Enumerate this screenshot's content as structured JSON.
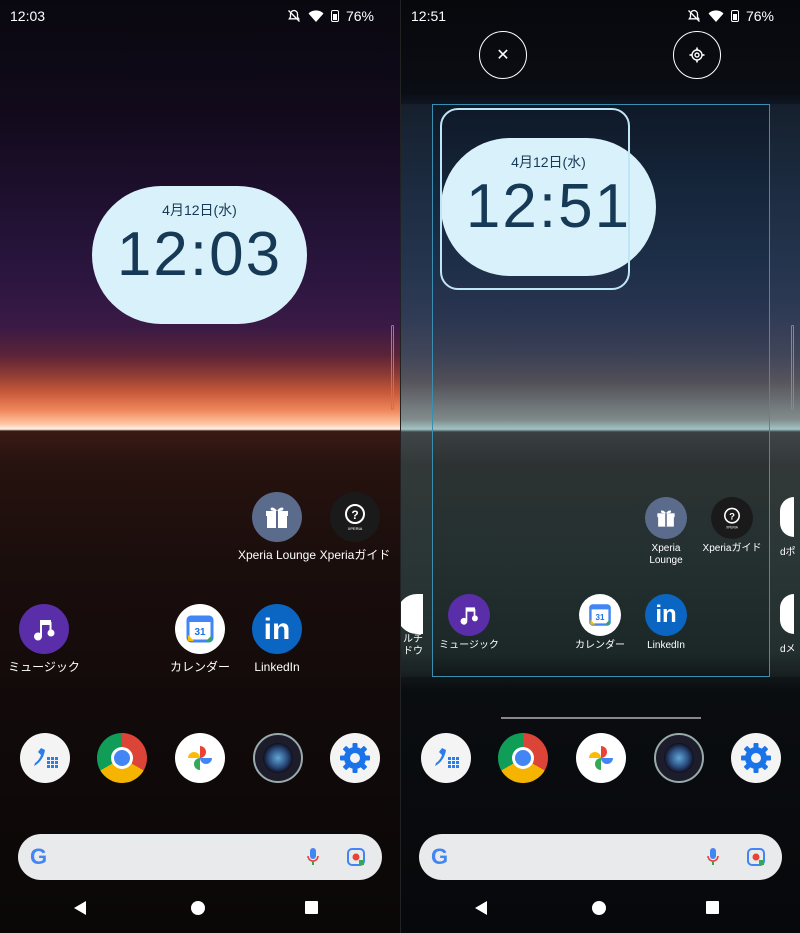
{
  "left": {
    "status": {
      "time": "12:03",
      "battery": "76%"
    },
    "clock": {
      "date": "4月12日(水)",
      "time": "12:03"
    },
    "apps": {
      "xperia_lounge": "Xperia Lounge",
      "xperia_guide": "Xperiaガイド",
      "music": "ミュージック",
      "calendar": "カレンダー",
      "linkedin": "LinkedIn"
    }
  },
  "right": {
    "status": {
      "time": "12:51",
      "battery": "76%"
    },
    "clock": {
      "date": "4月12日(水)",
      "time": "12:51"
    },
    "apps": {
      "xperia_lounge": "Xperia Lounge",
      "xperia_guide": "Xperiaガイド",
      "music": "ミュージック",
      "calendar": "カレンダー",
      "linkedin": "LinkedIn",
      "peek_left": "ルチドウ",
      "peek_right_top": "dポ",
      "peek_right_bottom": "dメ"
    },
    "edit": {
      "close_icon": "close-icon",
      "settings_icon": "gear-icon"
    }
  },
  "calendar_day": "31",
  "search_logo": "G",
  "colors": {
    "clock_bg": "#d9f1fb",
    "clock_text": "#163a55",
    "frame": "#3a8fb0"
  }
}
